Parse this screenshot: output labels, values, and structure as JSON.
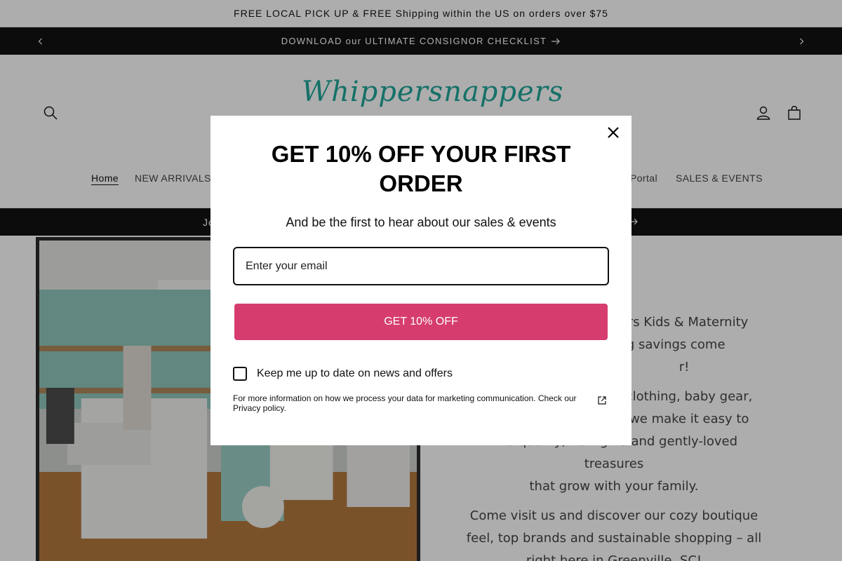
{
  "topbar": {
    "text": "FREE LOCAL PICK UP & FREE Shipping within the US on orders over $75"
  },
  "announcement": {
    "text": "DOWNLOAD our ULTIMATE CONSIGNOR CHECKLIST",
    "prev_icon": "chevron-left-icon",
    "next_icon": "chevron-right-icon"
  },
  "header": {
    "logo_text": "Whippersnappers",
    "nav": [
      {
        "label": "Home",
        "active": true
      },
      {
        "label": "NEW ARRIVALS"
      },
      {
        "label": "Portal"
      },
      {
        "label": "SALES & EVENTS"
      }
    ]
  },
  "banner2": {
    "text": "Jo"
  },
  "story": {
    "p1": "ers Kids & Maternity",
    "p1b": "big savings come",
    "p1c": "r!",
    "p2a": "or clothing, baby gear,",
    "p2b": "ft, we make it easy to",
    "p2c": "find quality, new gifts and gently-loved treasures",
    "p2d": "that grow with your family.",
    "p3a": "Come visit us and discover our cozy boutique",
    "p3b": "feel, top brands and sustainable shopping – all",
    "p3c": "right here in Greenville, SC!"
  },
  "modal": {
    "title": "GET 10% OFF YOUR FIRST ORDER",
    "subtitle": "And be the first to hear about our sales & events",
    "email_placeholder": "Enter your email",
    "cta_label": "GET 10% OFF",
    "consent_label": "Keep me up to date on news and offers",
    "privacy_text": "For more information on how we process your data for marketing communication. Check our Privacy policy.",
    "accent": "#d63d6e"
  }
}
